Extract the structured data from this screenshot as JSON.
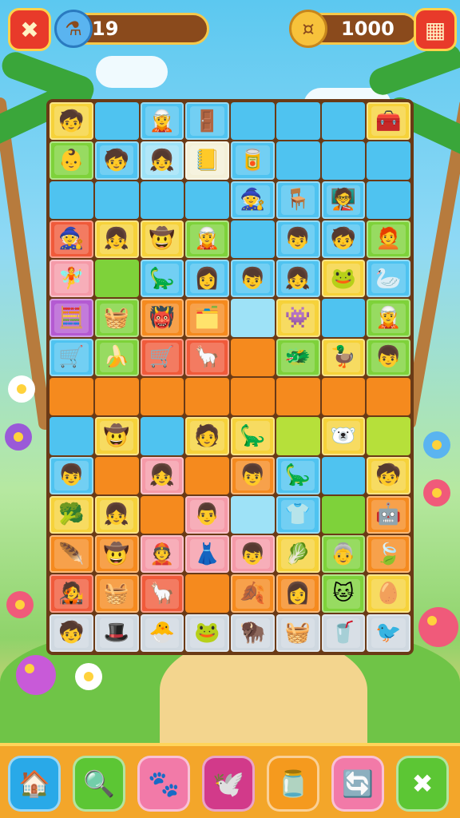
{
  "hud": {
    "close_icon": "close-x-icon",
    "potion_icon": "potion-icon",
    "moves_count": "19",
    "coin_icon": "coin-icon",
    "coins_count": "1000",
    "menu_icon": "menu-grid-icon"
  },
  "colors": {
    "blue": "#4fc3f0",
    "lightblue": "#9ee2f7",
    "green": "#7ed23a",
    "yellow": "#f6d23a",
    "orange": "#f58a1e",
    "pink": "#f59aa8",
    "purple": "#b45ad2",
    "red": "#f05a3a",
    "lime": "#b6e03a",
    "cream": "#f4f0d8",
    "gray": "#cfd8e0"
  },
  "board": {
    "columns": 8,
    "rows": 13,
    "cells": [
      [
        "yellow:🧒",
        "blue",
        "blue:🧝",
        "blue:🚪",
        "blue",
        "blue",
        "blue",
        "yellow:🧰"
      ],
      [
        "green:👶",
        "blue:🧒",
        "lightblue:👧",
        "cream:📒",
        "blue:🥫",
        "blue",
        "blue",
        "blue"
      ],
      [
        "blue",
        "blue",
        "blue",
        "blue",
        "blue:🧙",
        "blue:🪑",
        "blue:🧑‍🏫",
        "blue"
      ],
      [
        "red:🧙",
        "yellow:👧",
        "yellow:🤠",
        "green:🧝",
        "blue",
        "blue:👦",
        "blue:🧒",
        "green:🧑‍🦰"
      ],
      [
        "pink:🧚",
        "green",
        "blue:🦕",
        "blue:👩",
        "blue:👦",
        "blue:👧",
        "yellow:🐸",
        "blue:🦢"
      ],
      [
        "purple:🧮",
        "green:🧺",
        "orange:👹",
        "orange:🗂️",
        "lightblue",
        "yellow:👾",
        "blue",
        "green:🧝"
      ],
      [
        "blue:🛒",
        "green:🍌",
        "red:🛒",
        "red:🦙",
        "orange",
        "green:🐲",
        "yellow:🦆",
        "green:👦"
      ],
      [
        "orange",
        "orange",
        "orange",
        "orange",
        "orange",
        "orange",
        "orange",
        "orange"
      ],
      [
        "blue",
        "yellow:🤠",
        "blue",
        "yellow:🧑",
        "yellow:🦕",
        "lime",
        "yellow:🐻‍❄️",
        "lime"
      ],
      [
        "blue:👦",
        "orange",
        "pink:👧",
        "orange",
        "orange:👦",
        "blue:🦕",
        "blue",
        "yellow:🧒"
      ],
      [
        "yellow:🥦",
        "yellow:👧",
        "orange",
        "pink:👨",
        "lightblue",
        "blue:👕",
        "green",
        "orange:🤖"
      ],
      [
        "orange:🪶",
        "orange:🤠",
        "pink:👲",
        "pink:👗",
        "pink:👦",
        "yellow:🥬",
        "green:👵",
        "orange:🍃"
      ],
      [
        "red:🧑‍🎤",
        "orange:🧺",
        "red:🦙",
        "orange",
        "orange:🍂",
        "orange:👩",
        "green:🐱",
        "yellow:🥚"
      ],
      [
        "gray:🧒",
        "gray:🎩",
        "gray:🐣",
        "gray:🐸",
        "gray:🦬",
        "gray:🧺",
        "gray:🥤",
        "gray:🐦"
      ]
    ]
  },
  "bottombar": {
    "buttons": [
      {
        "name": "home",
        "icon": "🏠",
        "color": "#29a9e8"
      },
      {
        "name": "search",
        "icon": "🔍",
        "color": "#5cc634"
      },
      {
        "name": "paw",
        "icon": "🐾",
        "color": "#f27aa8"
      },
      {
        "name": "bird",
        "icon": "🕊️",
        "color": "#d23a8a"
      },
      {
        "name": "jar",
        "icon": "🫙",
        "color": "#f59a1e"
      },
      {
        "name": "refresh",
        "icon": "🔄",
        "color": "#f27aa8"
      },
      {
        "name": "close",
        "icon": "✖",
        "color": "#5cc634"
      }
    ]
  }
}
